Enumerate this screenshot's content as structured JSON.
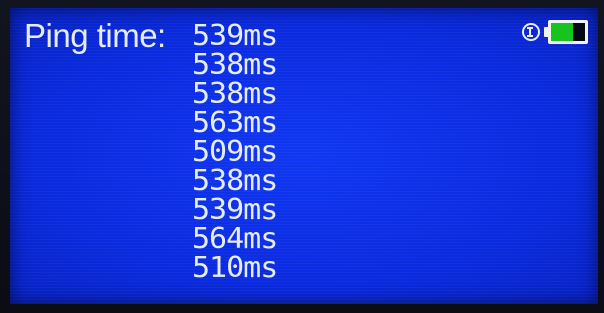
{
  "display": {
    "label": "Ping time:",
    "ping_times": [
      "539ms",
      "538ms",
      "538ms",
      "563ms",
      "509ms",
      "538ms",
      "539ms",
      "564ms",
      "510ms"
    ]
  },
  "status": {
    "info_icon": "info-icon",
    "battery_icon": "battery-icon",
    "battery_level": 0.65
  },
  "colors": {
    "screen_background": "#0a2be0",
    "text": "#e6ecff",
    "battery_charge": "#18c21f"
  }
}
